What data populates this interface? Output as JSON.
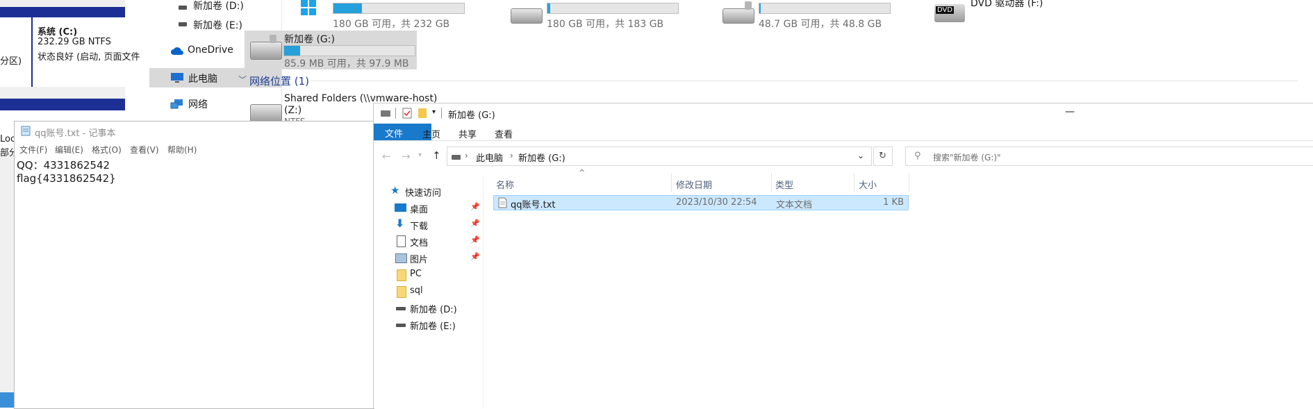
{
  "disk_mgmt": {
    "system_label": "系统 (C:)",
    "system_size": "232.29 GB NTFS",
    "system_status": "状态良好 (启动, 页面文件",
    "left_part": "分区)",
    "bitlocker": "Locker 已加密)",
    "left_part2": "部分区"
  },
  "explorer_bg": {
    "nav_items": [
      {
        "label": "新加卷 (D:)"
      },
      {
        "label": "新加卷 (E:)"
      },
      {
        "label": "OneDrive"
      },
      {
        "label": "此电脑"
      },
      {
        "label": "网络"
      }
    ],
    "drives": [
      {
        "free": "180 GB 可用，共 232 GB",
        "pct": 0.22
      },
      {
        "free": "180 GB 可用，共 183 GB",
        "pct": 0.02
      },
      {
        "free": "48.7 GB 可用，共 48.8 GB",
        "pct": 0.005
      },
      {
        "name": "DVD 驱动器 (F:)",
        "badge": "DVD"
      }
    ],
    "drive_g": {
      "name": "新加卷 (G:)",
      "free": "85.9 MB 可用，共 97.9 MB",
      "pct": 0.12
    },
    "net_section": "网络位置 (1)",
    "shared": {
      "name": "Shared Folders (\\\\vmware-host)",
      "letter": "(Z:)",
      "cut": "NTFS"
    }
  },
  "notepad": {
    "title": "qq账号.txt - 记事本",
    "menu": [
      "文件(F)",
      "编辑(E)",
      "格式(O)",
      "查看(V)",
      "帮助(H)"
    ],
    "lines": [
      "QQ：4331862542",
      "flag{4331862542}"
    ]
  },
  "explorer": {
    "title": "新加卷 (G:)",
    "ribbon_tabs": [
      "文件",
      "主页",
      "共享",
      "查看"
    ],
    "breadcrumb": [
      "此电脑",
      "新加卷 (G:)"
    ],
    "search_placeholder": "搜索\"新加卷 (G:)\"",
    "nav": [
      {
        "label": "快速访问",
        "icon": "star-icon"
      },
      {
        "label": "桌面",
        "icon": "desktop-icon",
        "pinned": true
      },
      {
        "label": "下载",
        "icon": "download-icon",
        "pinned": true
      },
      {
        "label": "文档",
        "icon": "document-icon",
        "pinned": true
      },
      {
        "label": "图片",
        "icon": "picture-icon",
        "pinned": true
      },
      {
        "label": "PC",
        "icon": "folder-icon"
      },
      {
        "label": "sql",
        "icon": "folder-icon"
      },
      {
        "label": "新加卷 (D:)",
        "icon": "drive-icon"
      },
      {
        "label": "新加卷 (E:)",
        "icon": "drive-icon"
      }
    ],
    "columns": [
      "名称",
      "修改日期",
      "类型",
      "大小"
    ],
    "files": [
      {
        "name": "qq账号.txt",
        "date": "2023/10/30 22:54",
        "type": "文本文档",
        "size": "1 KB"
      }
    ],
    "minimize": "—"
  },
  "colors": {
    "accent": "#1979ca",
    "selection": "#cce8ff",
    "bar_fill": "#26a0da",
    "disk_blue": "#1c2f94"
  }
}
